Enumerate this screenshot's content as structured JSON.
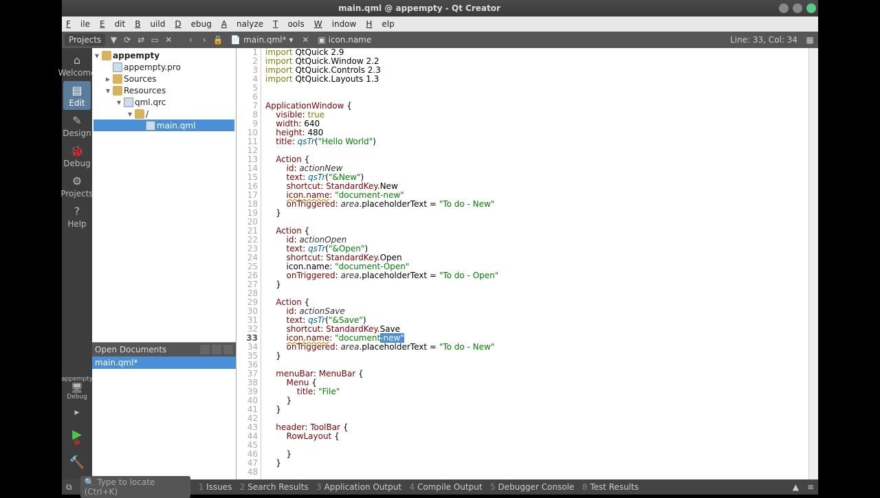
{
  "window": {
    "title": "main.qml @ appempty - Qt Creator"
  },
  "menubar": [
    "File",
    "Edit",
    "Build",
    "Debug",
    "Analyze",
    "Tools",
    "Window",
    "Help"
  ],
  "toolbar": {
    "project_dropdown": "Projects",
    "file_crumb": "main.qml*",
    "symbol_crumb": "icon.name",
    "cursor": "Line: 33, Col: 34"
  },
  "leftbar": {
    "items": [
      {
        "label": "Welcome",
        "icon": "⌂"
      },
      {
        "label": "Edit",
        "icon": "▤",
        "selected": true
      },
      {
        "label": "Design",
        "icon": "✎"
      },
      {
        "label": "Debug",
        "icon": "🐞"
      },
      {
        "label": "Projects",
        "icon": "⚙"
      },
      {
        "label": "Help",
        "icon": "?"
      }
    ],
    "target": {
      "name": "appempty",
      "config": "Debug",
      "icon": "🖥"
    }
  },
  "tree": {
    "root": "appempty",
    "pro": "appempty.pro",
    "sources": "Sources",
    "resources": "Resources",
    "qrc": "qml.qrc",
    "slash": "/",
    "mainfile": "main.qml"
  },
  "openDocs": {
    "title": "Open Documents",
    "items": [
      "main.qml*"
    ]
  },
  "code": {
    "lines": [
      {
        "n": 1,
        "pre": "",
        "txt": "import QtQuick 2.9",
        "k": [
          "import"
        ]
      },
      {
        "n": 2,
        "pre": "",
        "txt": "import QtQuick.Window 2.2",
        "k": [
          "import"
        ]
      },
      {
        "n": 3,
        "pre": "",
        "txt": "import QtQuick.Controls 2.3",
        "k": [
          "import"
        ]
      },
      {
        "n": 4,
        "pre": "",
        "txt": "import QtQuick.Layouts 1.3",
        "k": [
          "import"
        ]
      },
      {
        "n": 5,
        "pre": "",
        "txt": ""
      },
      {
        "n": 6,
        "pre": "",
        "txt": ""
      },
      {
        "n": 7,
        "pre": "",
        "txt": "ApplicationWindow {",
        "type": 1
      },
      {
        "n": 8,
        "pre": "    ",
        "txt": "visible: true"
      },
      {
        "n": 9,
        "pre": "    ",
        "txt": "width: 640"
      },
      {
        "n": 10,
        "pre": "    ",
        "txt": "height: 480"
      },
      {
        "n": 11,
        "pre": "    ",
        "txt": "title: qsTr(\"Hello World\")"
      },
      {
        "n": 12,
        "pre": "",
        "txt": ""
      },
      {
        "n": 13,
        "pre": "    ",
        "txt": "Action {",
        "type": 1
      },
      {
        "n": 14,
        "pre": "        ",
        "txt": "id: actionNew"
      },
      {
        "n": 15,
        "pre": "        ",
        "txt": "text: qsTr(\"&New\")"
      },
      {
        "n": 16,
        "pre": "        ",
        "txt": "shortcut: StandardKey.New"
      },
      {
        "n": 17,
        "pre": "        ",
        "txt": "icon.name: \"document-new\"",
        "warn": "icon.name"
      },
      {
        "n": 18,
        "pre": "        ",
        "txt": "onTriggered: area.placeholderText = \"To do - New\""
      },
      {
        "n": 19,
        "pre": "    ",
        "txt": "}"
      },
      {
        "n": 20,
        "pre": "",
        "txt": ""
      },
      {
        "n": 21,
        "pre": "    ",
        "txt": "Action {",
        "type": 1
      },
      {
        "n": 22,
        "pre": "        ",
        "txt": "id: actionOpen"
      },
      {
        "n": 23,
        "pre": "        ",
        "txt": "text: qsTr(\"&Open\")"
      },
      {
        "n": 24,
        "pre": "        ",
        "txt": "shortcut: StandardKey.Open"
      },
      {
        "n": 25,
        "pre": "        ",
        "txt": "icon.name: \"document-Open\""
      },
      {
        "n": 26,
        "pre": "        ",
        "txt": "onTriggered: area.placeholderText = \"To do - Open\""
      },
      {
        "n": 27,
        "pre": "    ",
        "txt": "}"
      },
      {
        "n": 28,
        "pre": "",
        "txt": ""
      },
      {
        "n": 29,
        "pre": "    ",
        "txt": "Action {",
        "type": 1
      },
      {
        "n": 30,
        "pre": "        ",
        "txt": "id: actionSave"
      },
      {
        "n": 31,
        "pre": "        ",
        "txt": "text: qsTr(\"&Save\")"
      },
      {
        "n": 32,
        "pre": "        ",
        "txt": "shortcut: StandardKey.Save"
      },
      {
        "n": 33,
        "pre": "        ",
        "txt": "icon.name: \"document-new\"",
        "warn": "icon.name",
        "sel": "-new\"",
        "cur": true
      },
      {
        "n": 34,
        "pre": "        ",
        "txt": "onTriggered: area.placeholderText = \"To do - New\""
      },
      {
        "n": 35,
        "pre": "    ",
        "txt": "}"
      },
      {
        "n": 36,
        "pre": "",
        "txt": ""
      },
      {
        "n": 37,
        "pre": "    ",
        "txt": "menuBar: MenuBar {",
        "type": 1
      },
      {
        "n": 38,
        "pre": "        ",
        "txt": "Menu {",
        "type": 1
      },
      {
        "n": 39,
        "pre": "            ",
        "txt": "title: \"File\""
      },
      {
        "n": 40,
        "pre": "        ",
        "txt": "}"
      },
      {
        "n": 41,
        "pre": "    ",
        "txt": "}"
      },
      {
        "n": 42,
        "pre": "",
        "txt": ""
      },
      {
        "n": 43,
        "pre": "    ",
        "txt": "header: ToolBar {",
        "type": 1
      },
      {
        "n": 44,
        "pre": "        ",
        "txt": "RowLayout {",
        "type": 1
      },
      {
        "n": 45,
        "pre": "",
        "txt": ""
      },
      {
        "n": 46,
        "pre": "        ",
        "txt": "}"
      },
      {
        "n": 47,
        "pre": "    ",
        "txt": "}"
      },
      {
        "n": 48,
        "pre": "",
        "txt": ""
      }
    ]
  },
  "statusbar": {
    "locate_placeholder": "Type to locate (Ctrl+K)",
    "panels": [
      {
        "num": "1",
        "label": "Issues"
      },
      {
        "num": "2",
        "label": "Search Results"
      },
      {
        "num": "3",
        "label": "Application Output"
      },
      {
        "num": "4",
        "label": "Compile Output"
      },
      {
        "num": "5",
        "label": "Debugger Console"
      },
      {
        "num": "8",
        "label": "Test Results"
      }
    ]
  }
}
